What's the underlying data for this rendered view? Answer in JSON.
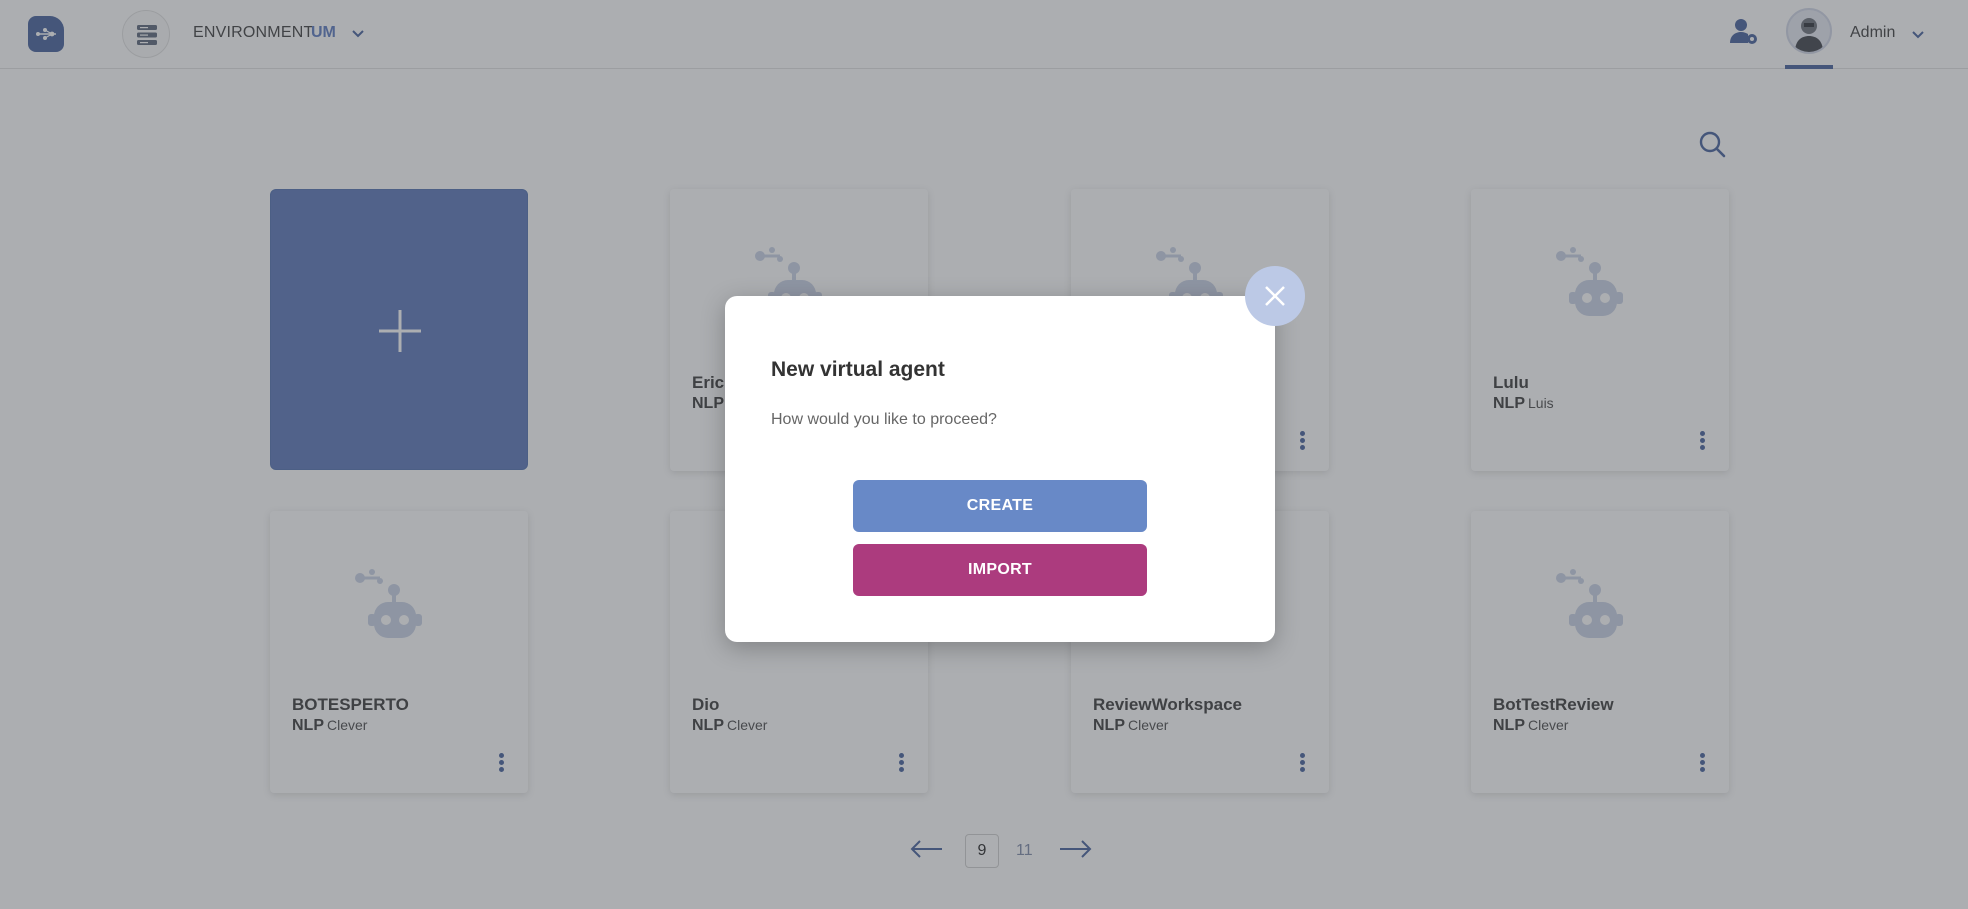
{
  "header": {
    "environment_label": "ENVIRONMENT",
    "environment_value": "UM",
    "user_name": "Admin"
  },
  "icons": {
    "logo": "app-logo",
    "environment": "server-stack-icon",
    "user_settings": "user-gear-icon",
    "search": "search-icon",
    "card_image": "robot-icon",
    "card_menu": "more-vertical-icon",
    "add": "plus-icon",
    "close": "close-icon"
  },
  "cards": [
    {
      "name": "",
      "type": "NLP",
      "owner": ""
    },
    {
      "name": "",
      "type": "",
      "owner": ""
    },
    {
      "name": "Lulu",
      "type": "NLP",
      "owner": "Luis"
    },
    {
      "name": "BOTESPERTO",
      "type": "NLP",
      "owner": "Clever"
    },
    {
      "name": "Dio",
      "type": "NLP",
      "owner": "Clever"
    },
    {
      "name": "ReviewWorkspace",
      "type": "NLP",
      "owner": "Clever"
    },
    {
      "name": "BotTestReview",
      "type": "NLP",
      "owner": "Clever"
    }
  ],
  "card_partial_name": "Erick",
  "pagination": {
    "current": "9",
    "total": "11",
    "prev": "⟵",
    "next": "⟶"
  },
  "modal": {
    "title": "New virtual agent",
    "text": "How would you like to proceed?",
    "create_label": "CREATE",
    "import_label": "IMPORT"
  },
  "colors": {
    "primary": "#445f9b",
    "create_button": "#6889c7",
    "import_button": "#ac3b7e",
    "add_card": "#5976b8"
  }
}
